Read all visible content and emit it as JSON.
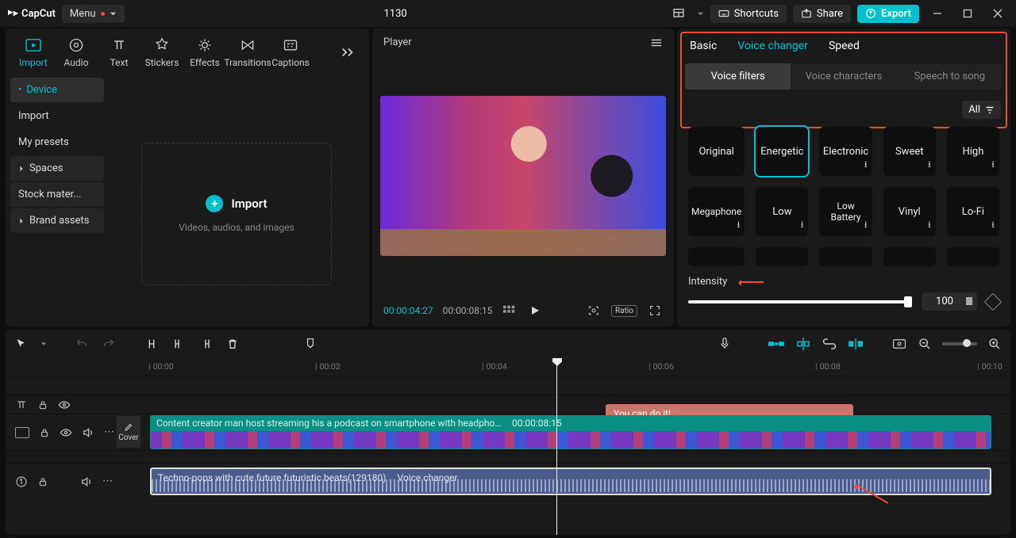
{
  "titlebar": {
    "app_name": "CapCut",
    "menu_label": "Menu",
    "doc_title": "1130",
    "shortcuts": "Shortcuts",
    "share": "Share",
    "export": "Export"
  },
  "left": {
    "tabs": [
      "Import",
      "Audio",
      "Text",
      "Stickers",
      "Effects",
      "Transitions",
      "Captions"
    ],
    "nav": {
      "device": "Device",
      "import": "Import",
      "my_presets": "My presets",
      "spaces": "Spaces",
      "stock_materials": "Stock mater...",
      "brand_assets": "Brand assets"
    },
    "drop": {
      "title": "Import",
      "sub": "Videos, audios, and images"
    }
  },
  "player": {
    "title": "Player",
    "current": "00:00:04:27",
    "duration": "00:00:08:15",
    "ratio": "Ratio"
  },
  "right": {
    "tabs": {
      "basic": "Basic",
      "voice_changer": "Voice changer",
      "speed": "Speed"
    },
    "segments": {
      "voice_filters": "Voice filters",
      "voice_characters": "Voice characters",
      "speech_to_song": "Speech to song"
    },
    "all": "All",
    "filters": {
      "original": "Original",
      "energetic": "Energetic",
      "electronic": "Electronic",
      "sweet": "Sweet",
      "high": "High",
      "megaphone": "Megaphone",
      "low": "Low",
      "low_battery": "Low Battery",
      "vinyl": "Vinyl",
      "lofi": "Lo-Fi"
    },
    "intensity_label": "Intensity",
    "intensity_value": "100"
  },
  "timeline": {
    "ticks": [
      "00:00",
      "00:02",
      "00:04",
      "00:06",
      "00:08",
      "00:10"
    ],
    "text_clip": "You can do it!",
    "video_title": "Content creator man host streaming his a podcast on smartphone with headphones",
    "video_time": "00:00:08:15",
    "cover": "Cover",
    "audio_title": "Techno-pops with cute future futuristic beats(129180)",
    "audio_effect": "Voice changer"
  }
}
